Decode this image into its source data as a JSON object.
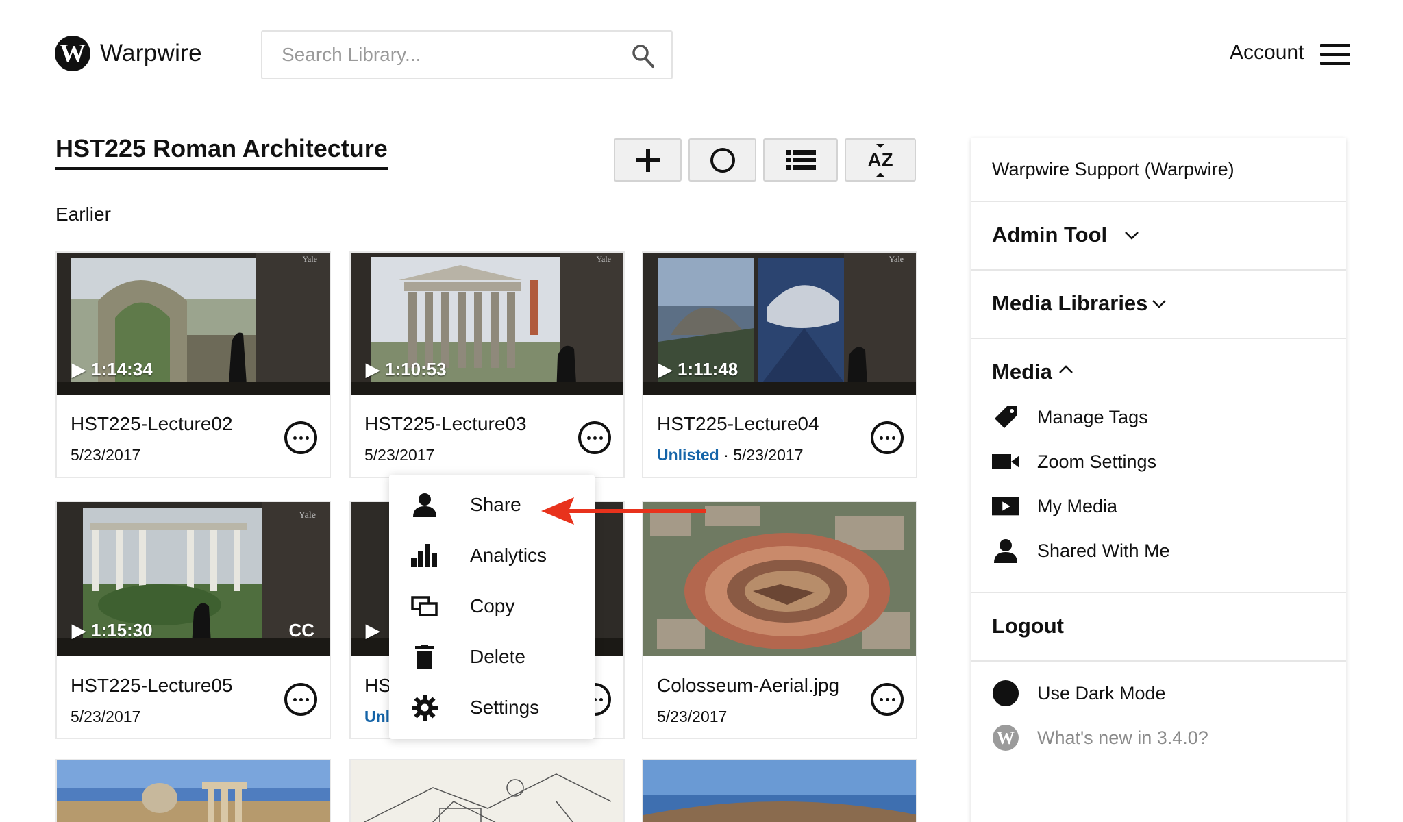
{
  "header": {
    "app_name": "Warpwire",
    "logo_letter": "W",
    "search_placeholder": "Search Library...",
    "account_label": "Account"
  },
  "page": {
    "title": "HST225 Roman Architecture",
    "section_label": "Earlier",
    "toolbar": [
      "add-icon",
      "circle-icon",
      "list-view-icon",
      "sort-az-icon"
    ],
    "sort_label": "AZ"
  },
  "cards": [
    {
      "title": "HST225-Lecture02",
      "date": "5/23/2017",
      "duration": "1:14:34",
      "watermark": "Yale"
    },
    {
      "title": "HST225-Lecture03",
      "date": "5/23/2017",
      "duration": "1:10:53",
      "watermark": "Yale"
    },
    {
      "title": "HST225-Lecture04",
      "status": "Unlisted",
      "separator": "·",
      "date": "5/23/2017",
      "duration": "1:11:48",
      "watermark": "Yale"
    },
    {
      "title": "HST225-Lecture05",
      "date": "5/23/2017",
      "duration": "1:15:30",
      "cc": "CC",
      "watermark": "Yale"
    },
    {
      "title_partial": "HS",
      "status_partial": "Unl"
    },
    {
      "title": "Colosseum-Aerial.jpg",
      "date": "5/23/2017"
    }
  ],
  "context_menu": {
    "items": [
      {
        "label": "Share",
        "icon": "person-icon"
      },
      {
        "label": "Analytics",
        "icon": "bar-chart-icon"
      },
      {
        "label": "Copy",
        "icon": "copy-icon"
      },
      {
        "label": "Delete",
        "icon": "trash-icon"
      },
      {
        "label": "Settings",
        "icon": "gear-icon"
      }
    ]
  },
  "sidebar": {
    "user": "Warpwire Support (Warpwire)",
    "admin_tool": "Admin Tool",
    "media_libraries": "Media Libraries",
    "media": "Media",
    "media_items": [
      {
        "label": "Manage Tags",
        "icon": "tag-icon"
      },
      {
        "label": "Zoom Settings",
        "icon": "video-camera-icon"
      },
      {
        "label": "My Media",
        "icon": "play-box-icon"
      },
      {
        "label": "Shared With Me",
        "icon": "person-icon"
      }
    ],
    "logout": "Logout",
    "dark_mode": "Use Dark Mode",
    "whats_new": "What's new in 3.4.0?"
  },
  "colors": {
    "accent_link": "#1564a8",
    "annotation_arrow": "#e8321c"
  }
}
